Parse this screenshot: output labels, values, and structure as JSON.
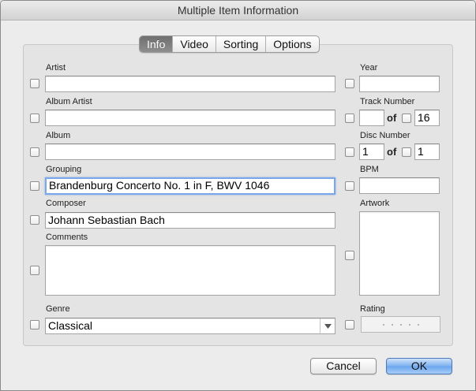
{
  "window": {
    "title": "Multiple Item Information"
  },
  "tabs": [
    "Info",
    "Video",
    "Sorting",
    "Options"
  ],
  "active_tab": "Info",
  "left": {
    "artist": {
      "label": "Artist",
      "value": ""
    },
    "album_artist": {
      "label": "Album Artist",
      "value": ""
    },
    "album": {
      "label": "Album",
      "value": ""
    },
    "grouping": {
      "label": "Grouping",
      "value": "Brandenburg Concerto No. 1 in F, BWV 1046"
    },
    "composer": {
      "label": "Composer",
      "value": "Johann Sebastian Bach"
    },
    "comments": {
      "label": "Comments",
      "value": ""
    },
    "genre": {
      "label": "Genre",
      "value": "Classical"
    }
  },
  "right": {
    "year": {
      "label": "Year",
      "value": ""
    },
    "track": {
      "label": "Track Number",
      "value": "",
      "of": "of",
      "total": "16"
    },
    "disc": {
      "label": "Disc Number",
      "value": "1",
      "of": "of",
      "total": "1"
    },
    "bpm": {
      "label": "BPM",
      "value": ""
    },
    "artwork": {
      "label": "Artwork"
    },
    "rating": {
      "label": "Rating",
      "stars": 0,
      "max": 5
    }
  },
  "buttons": {
    "cancel": "Cancel",
    "ok": "OK"
  },
  "colors": {
    "focus_ring": "#7aa7e6",
    "default_button": "#6aa5ee"
  }
}
